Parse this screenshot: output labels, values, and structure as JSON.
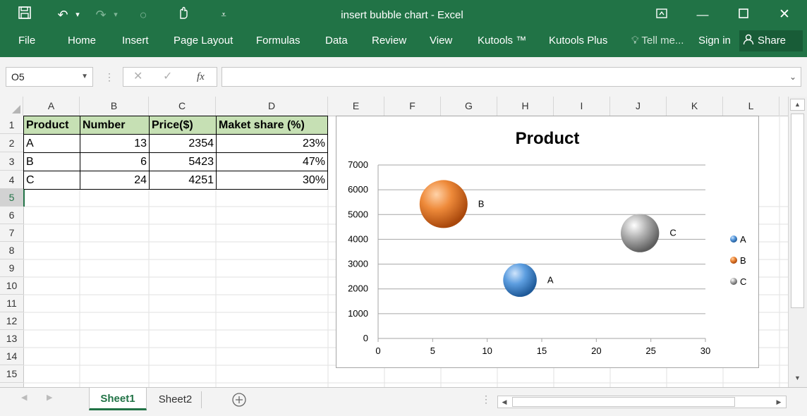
{
  "title_bar": {
    "title": "insert bubble chart - Excel",
    "icons": [
      "save-icon",
      "undo-icon",
      "redo-icon",
      "circle-icon",
      "touch-mode-icon",
      "customize-qat-icon"
    ],
    "window_icons": [
      "ribbon-display-icon",
      "minimize-icon",
      "maximize-icon",
      "close-icon"
    ]
  },
  "ribbon": {
    "tabs": [
      "File",
      "Home",
      "Insert",
      "Page Layout",
      "Formulas",
      "Data",
      "Review",
      "View",
      "Kutools ™",
      "Kutools Plus"
    ],
    "tell_me": "Tell me...",
    "sign_in": "Sign in",
    "share": "Share"
  },
  "formula_bar": {
    "name_box": "O5",
    "fx_label": "fx",
    "formula": ""
  },
  "grid": {
    "columns": [
      "A",
      "B",
      "C",
      "D",
      "E",
      "F",
      "G",
      "H",
      "I",
      "J",
      "K",
      "L"
    ],
    "rows": [
      "1",
      "2",
      "3",
      "4",
      "5",
      "6",
      "7",
      "8",
      "9",
      "10",
      "11",
      "12",
      "13",
      "14",
      "15"
    ],
    "selected_row": "5",
    "table": {
      "headers": [
        "Product",
        "Number",
        "Price($)",
        "Maket share (%)"
      ],
      "rows": [
        [
          "A",
          "13",
          "2354",
          "23%"
        ],
        [
          "B",
          "6",
          "5423",
          "47%"
        ],
        [
          "C",
          "24",
          "4251",
          "30%"
        ]
      ]
    },
    "header_fill": "#c6e0b4"
  },
  "chart_data": {
    "type": "scatter",
    "title": "Product",
    "xlabel": "",
    "ylabel": "",
    "xlim": [
      0,
      30
    ],
    "ylim": [
      0,
      7000
    ],
    "x_ticks": [
      "0",
      "5",
      "10",
      "15",
      "20",
      "25",
      "30"
    ],
    "y_ticks": [
      "0",
      "1000",
      "2000",
      "3000",
      "4000",
      "5000",
      "6000",
      "7000"
    ],
    "grid": true,
    "legend_position": "right",
    "series": [
      {
        "name": "A",
        "x": 13,
        "y": 2354,
        "size": 23,
        "color": "#3a7cc4"
      },
      {
        "name": "B",
        "x": 6,
        "y": 5423,
        "size": 47,
        "color": "#e0731f"
      },
      {
        "name": "C",
        "x": 24,
        "y": 4251,
        "size": 30,
        "color": "#9a9a9a"
      }
    ]
  },
  "sheets": {
    "tabs": [
      "Sheet1",
      "Sheet2"
    ],
    "active": "Sheet1"
  },
  "colors": {
    "brand": "#217346",
    "brand_dark": "#185c37",
    "active_tab_text": "#217346"
  }
}
